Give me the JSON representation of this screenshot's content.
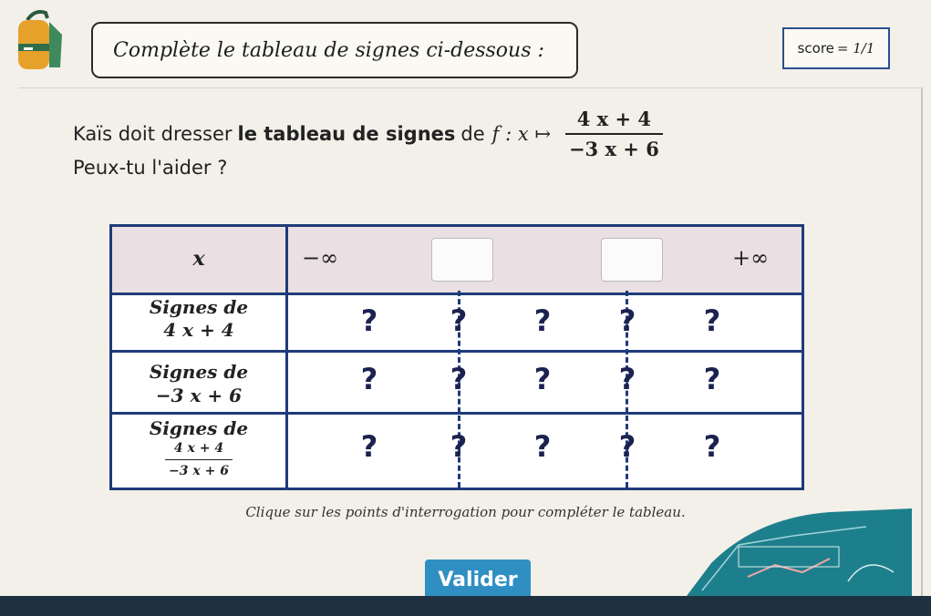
{
  "header": {
    "title": "Complète le tableau de signes ci-dessous :",
    "score_label": "score",
    "score_value": "= 1/1"
  },
  "statement": {
    "prefix": "Kaïs doit dresser",
    "bold": "le tableau de signes",
    "middle": "de",
    "func": "f : x ↦",
    "numerator": "4 x + 4",
    "denominator": "−3 x + 6",
    "question": "Peux-tu l'aider ?"
  },
  "table": {
    "x_label": "x",
    "minus_inf": "−∞",
    "plus_inf": "+∞",
    "rows": [
      {
        "label_top": "Signes de",
        "label_bottom": "4 x + 4",
        "cells": [
          "?",
          "?",
          "?",
          "?",
          "?"
        ]
      },
      {
        "label_top": "Signes de",
        "label_bottom": "−3 x + 6",
        "cells": [
          "?",
          "?",
          "?",
          "?",
          "?"
        ]
      },
      {
        "label_top": "Signes de",
        "frac_num": "4 x + 4",
        "frac_den": "−3 x + 6",
        "cells": [
          "?",
          "?",
          "?",
          "?",
          "?"
        ]
      }
    ]
  },
  "hint": "Clique sur les points d'interrogation pour compléter le tableau.",
  "validate_label": "Valider",
  "colors": {
    "table_border": "#1f3a7a",
    "header_bg": "#eadfe2",
    "button": "#2f8fc3",
    "question_mark": "#1b2250"
  }
}
